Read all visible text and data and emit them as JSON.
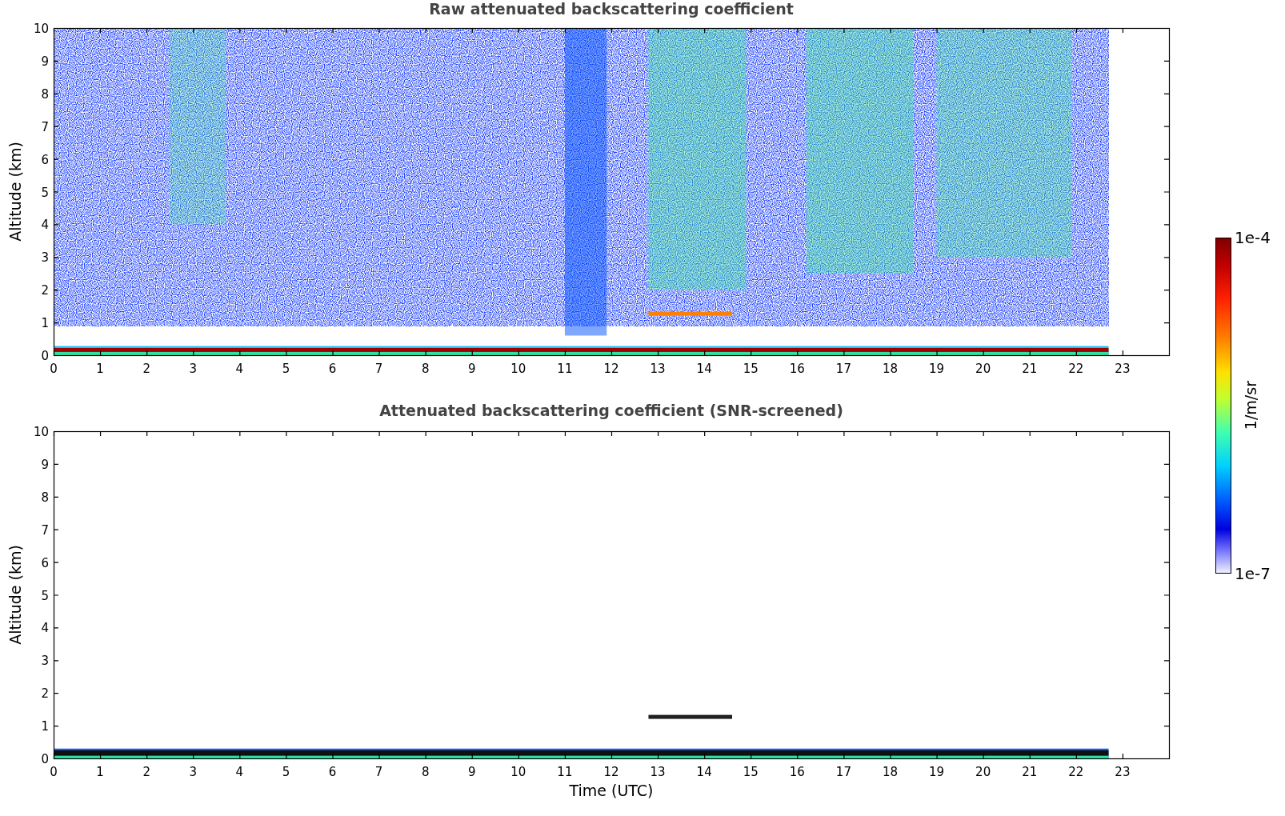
{
  "panels": [
    {
      "kind": "raw",
      "title": "Raw attenuated backscattering coefficient",
      "ylabel": "Altitude (km)",
      "yticks": [
        "10",
        "9",
        "8",
        "7",
        "6",
        "5",
        "4",
        "3",
        "2",
        "1",
        "0"
      ],
      "xticks": [
        "0",
        "1",
        "2",
        "3",
        "4",
        "5",
        "6",
        "7",
        "8",
        "9",
        "10",
        "11",
        "12",
        "13",
        "14",
        "15",
        "16",
        "17",
        "18",
        "19",
        "20",
        "21",
        "22",
        "23"
      ]
    },
    {
      "kind": "screened",
      "title": "Attenuated backscattering coefficient (SNR-screened)",
      "ylabel": "Altitude (km)",
      "yticks": [
        "10",
        "9",
        "8",
        "7",
        "6",
        "5",
        "4",
        "3",
        "2",
        "1",
        "0"
      ],
      "xticks": [
        "0",
        "1",
        "2",
        "3",
        "4",
        "5",
        "6",
        "7",
        "8",
        "9",
        "10",
        "11",
        "12",
        "13",
        "14",
        "15",
        "16",
        "17",
        "18",
        "19",
        "20",
        "21",
        "22",
        "23"
      ],
      "xlabel": "Time (UTC)"
    }
  ],
  "colorbar": {
    "max_label": "1e-4",
    "min_label": "1e-7",
    "label": "1/m/sr"
  }
}
